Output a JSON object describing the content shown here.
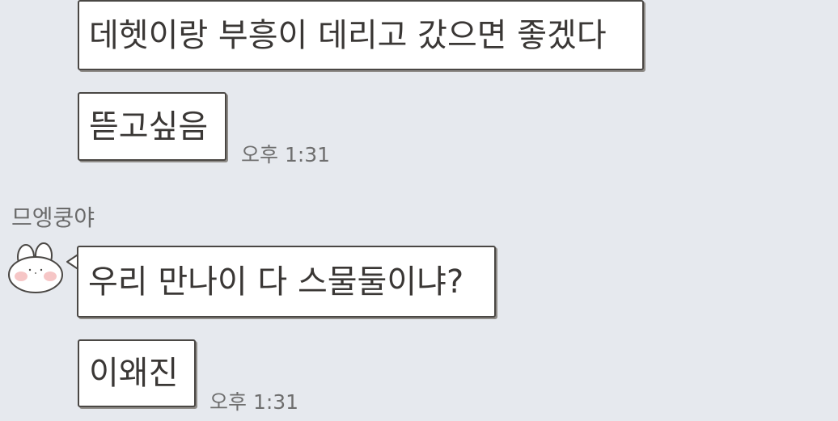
{
  "chat": {
    "messages": [
      {
        "text": "데헷이랑 부흥이 데리고 갔으면 좋겠다"
      },
      {
        "text": "뜯고싶음",
        "time": "오후 1:31"
      },
      {
        "sender": "므엥쿵야",
        "text": "우리 만나이 다 스물둘이냐?"
      },
      {
        "text": "이왜진",
        "time": "오후 1:31"
      }
    ]
  }
}
